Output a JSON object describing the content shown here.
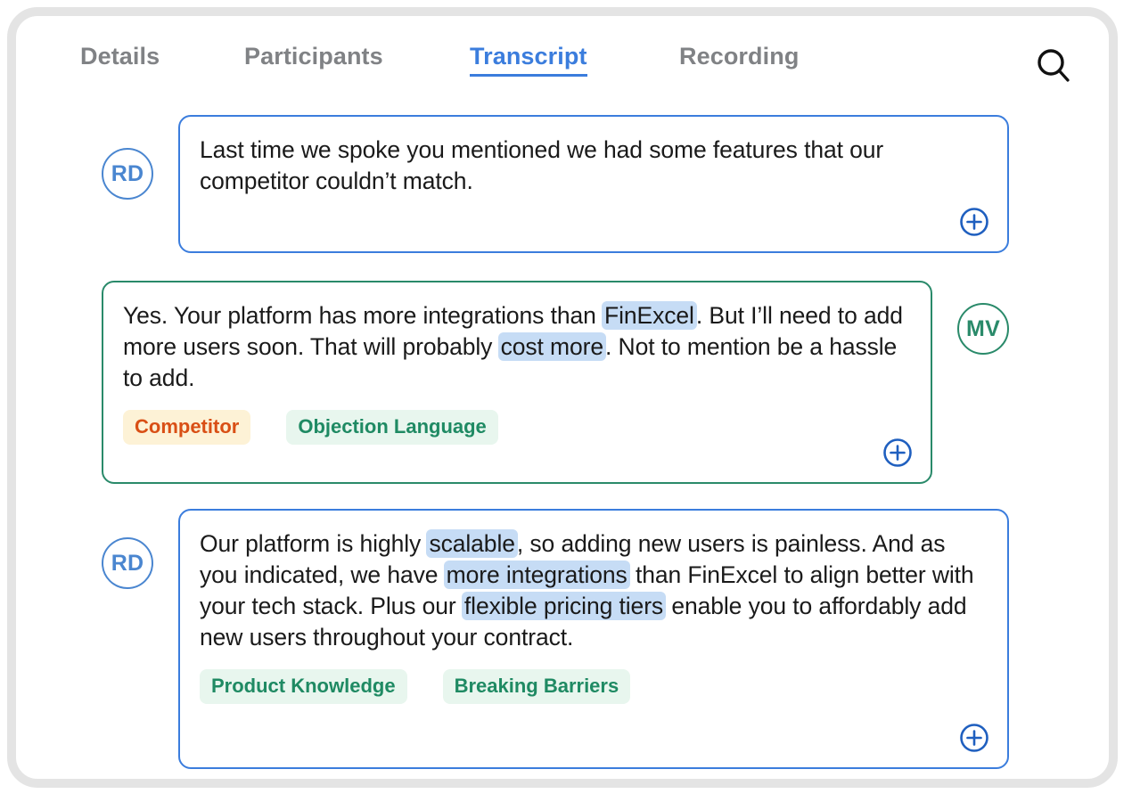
{
  "tabs": [
    {
      "label": "Details",
      "active": false
    },
    {
      "label": "Participants",
      "active": false
    },
    {
      "label": "Transcript",
      "active": true
    },
    {
      "label": "Recording",
      "active": false
    }
  ],
  "search": {
    "icon": "search-icon",
    "label": "Search"
  },
  "colors": {
    "card_border": "#e4e4e4",
    "accent_blue": "#3b7ddd",
    "avatar_blue": "#4a86d0",
    "accent_green": "#2a8a6a",
    "highlight": "#c6dcf5",
    "tag_orange_text": "#d94f15",
    "tag_orange_bg": "#fdf2d6",
    "tag_green_text": "#1f8a63",
    "tag_green_bg": "#e8f6ee",
    "tab_inactive": "#808285",
    "body_text": "#1a1a1a"
  },
  "messages": [
    {
      "speaker_initials": "RD",
      "speaker_color": "blue",
      "side": "left",
      "segments": [
        {
          "text": "Last time we spoke you mentioned we had some features that our competitor couldn’t match.",
          "highlight": false
        }
      ],
      "tags": [],
      "add_action": "add-to-playlist"
    },
    {
      "speaker_initials": "MV",
      "speaker_color": "green",
      "side": "right",
      "segments": [
        {
          "text": "Yes. Your platform has more integrations than ",
          "highlight": false
        },
        {
          "text": "FinExcel",
          "highlight": true
        },
        {
          "text": ". But I’ll need to add more users soon. That will probably ",
          "highlight": false
        },
        {
          "text": "cost more",
          "highlight": true
        },
        {
          "text": ". Not to mention be a hassle to add.",
          "highlight": false
        }
      ],
      "tags": [
        {
          "label": "Competitor",
          "style": "orange"
        },
        {
          "label": "Objection Language",
          "style": "green"
        }
      ],
      "add_action": "add-to-playlist"
    },
    {
      "speaker_initials": "RD",
      "speaker_color": "blue",
      "side": "left",
      "segments": [
        {
          "text": "Our platform is highly ",
          "highlight": false
        },
        {
          "text": "scalable",
          "highlight": true
        },
        {
          "text": ", so adding new users is painless. And as you indicated, we have ",
          "highlight": false
        },
        {
          "text": "more integrations",
          "highlight": true
        },
        {
          "text": " than FinExcel to align better with your tech stack. Plus our ",
          "highlight": false
        },
        {
          "text": "flexible pricing tiers",
          "highlight": true
        },
        {
          "text": " enable you to affordably add new users throughout your contract.",
          "highlight": false
        }
      ],
      "tags": [
        {
          "label": "Product Knowledge",
          "style": "green"
        },
        {
          "label": "Breaking Barriers",
          "style": "green"
        }
      ],
      "add_action": "add-to-playlist"
    }
  ]
}
